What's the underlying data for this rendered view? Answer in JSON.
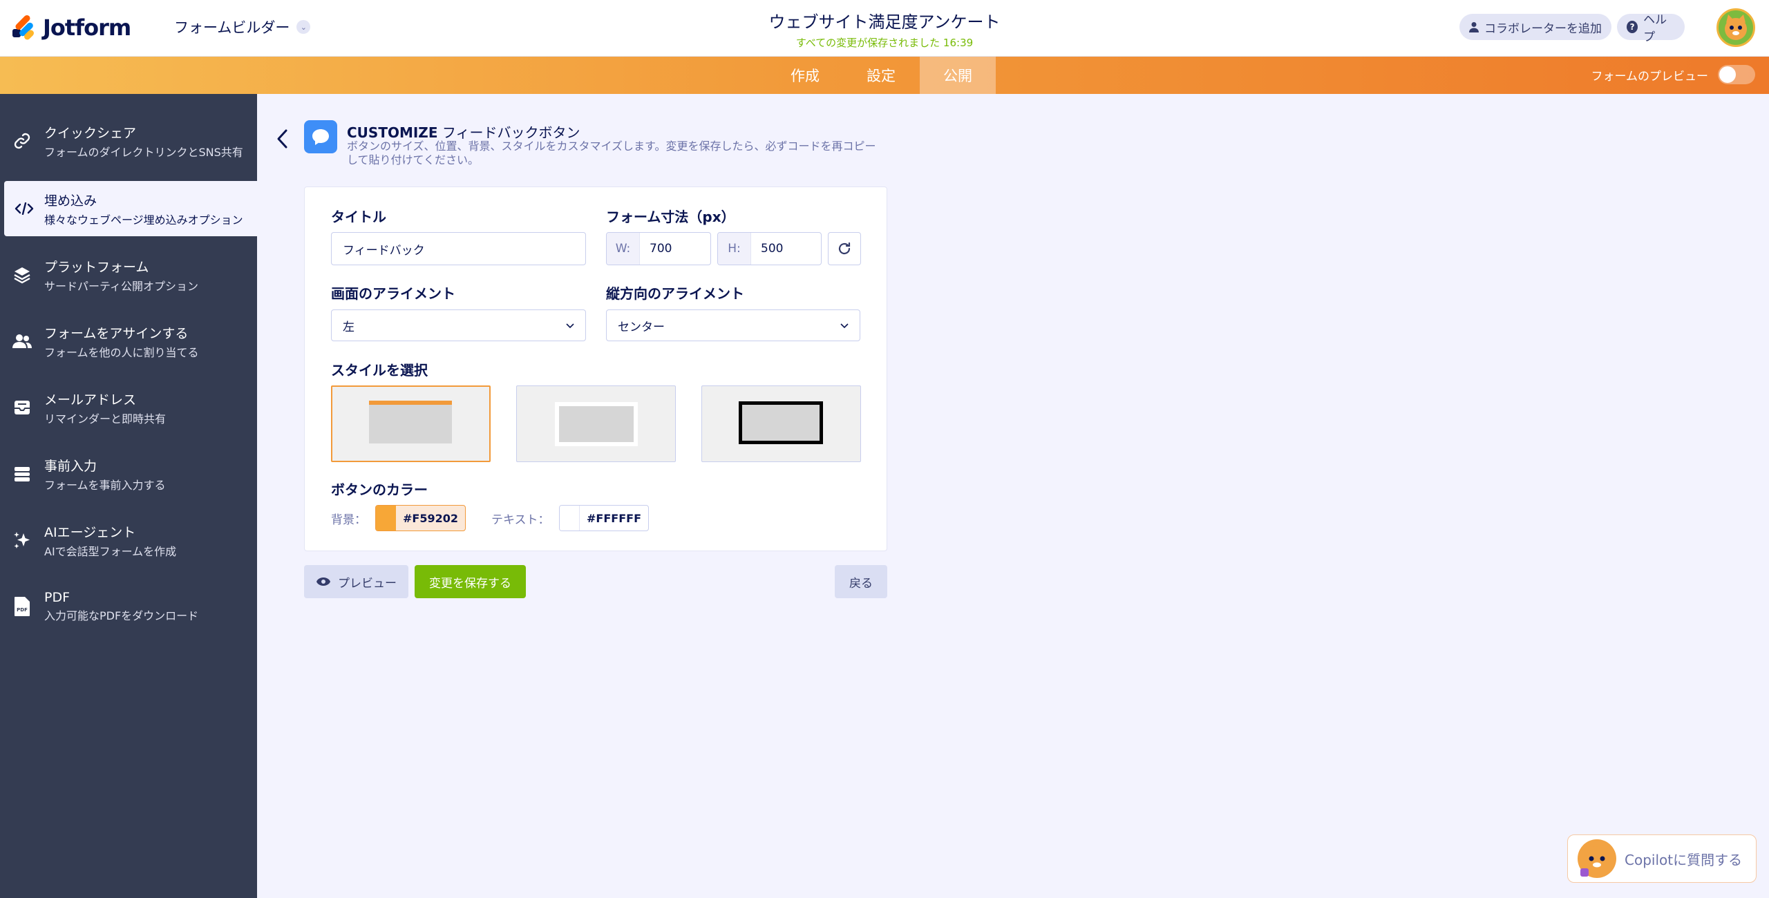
{
  "header": {
    "logo_text": "Jotform",
    "builder_label": "フォームビルダー",
    "form_title": "ウェブサイト満足度アンケート",
    "save_status": "すべての変更が保存されました 16:39",
    "collab_label": "コラボレーターを追加",
    "help_label": "ヘルプ"
  },
  "nav": {
    "tabs": [
      "作成",
      "設定",
      "公開"
    ],
    "active_tab": "公開",
    "preview_label": "フォームのプレビュー"
  },
  "sidebar": {
    "items": [
      {
        "label": "クイックシェア",
        "sub": "フォームのダイレクトリンクとSNS共有",
        "icon": "link-icon"
      },
      {
        "label": "埋め込み",
        "sub": "様々なウェブページ埋め込みオプション",
        "icon": "code-icon"
      },
      {
        "label": "プラットフォーム",
        "sub": "サードパーティ公開オプション",
        "icon": "layers-icon"
      },
      {
        "label": "フォームをアサインする",
        "sub": "フォームを他の人に割り当てる",
        "icon": "users-icon"
      },
      {
        "label": "メールアドレス",
        "sub": "リマインダーと即時共有",
        "icon": "inbox-icon"
      },
      {
        "label": "事前入力",
        "sub": "フォームを事前入力する",
        "icon": "list-icon"
      },
      {
        "label": "AIエージェント",
        "sub": "AIで会話型フォームを作成",
        "icon": "sparkle-icon"
      },
      {
        "label": "PDF",
        "sub": "入力可能なPDFをダウンロード",
        "icon": "pdf-icon"
      }
    ]
  },
  "customize": {
    "title_bold": "CUSTOMIZE",
    "title_rest": " フィードバックボタン",
    "description": "ボタンのサイズ、位置、背景、スタイルをカスタマイズします。変更を保存したら、必ずコードを再コピーして貼り付けてください。"
  },
  "form": {
    "title_label": "タイトル",
    "title_value": "フィードバック",
    "size_label": "フォーム寸法（px）",
    "w_prefix": "W:",
    "w_value": "700",
    "h_prefix": "H:",
    "h_value": "500",
    "screen_align_label": "画面のアライメント",
    "screen_align_value": "左",
    "vertical_align_label": "縦方向のアライメント",
    "vertical_align_value": "センター",
    "style_label": "スタイルを選択",
    "selected_style": 1,
    "color_label": "ボタンのカラー",
    "bg_label": "背景：",
    "bg_color": "#F59202",
    "text_label": "テキスト：",
    "text_color": "#FFFFFF"
  },
  "actions": {
    "preview": "プレビュー",
    "save": "変更を保存する",
    "back": "戻る"
  },
  "copilot": {
    "label": "Copilotに質問する"
  },
  "colors": {
    "accent_orange": "#f29a3a",
    "save_green": "#78bb07",
    "sidebar_bg": "#343c52",
    "navy": "#0a1551"
  }
}
